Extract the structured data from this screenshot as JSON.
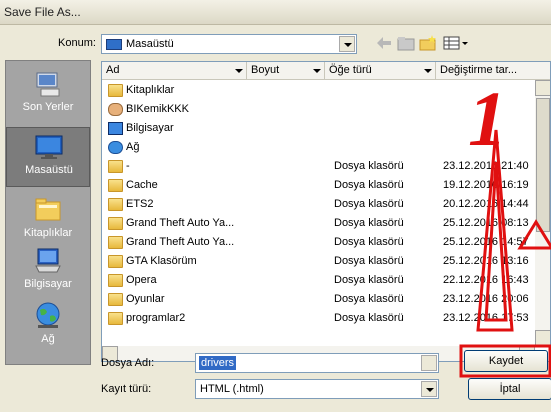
{
  "window": {
    "title": "Save File As..."
  },
  "location": {
    "label": "Konum:",
    "value": "Masaüstü"
  },
  "toolbar": {
    "icons": [
      "back-arrow-icon",
      "up-folder-icon",
      "new-folder-icon",
      "view-menu-icon"
    ]
  },
  "places": [
    {
      "label": "Son Yerler",
      "icon": "recent-places-icon"
    },
    {
      "label": "Masaüstü",
      "icon": "desktop-icon",
      "selected": true
    },
    {
      "label": "Kitaplıklar",
      "icon": "libraries-icon"
    },
    {
      "label": "Bilgisayar",
      "icon": "computer-icon"
    },
    {
      "label": "Ağ",
      "icon": "network-icon"
    }
  ],
  "columns": [
    "Ad",
    "Boyut",
    "Öğe türü",
    "Değiştirme tar..."
  ],
  "files": [
    {
      "name": "Kitaplıklar",
      "type": "",
      "date": "",
      "icon": "library-icon"
    },
    {
      "name": "BIKemikKKK",
      "type": "",
      "date": "",
      "icon": "user-icon"
    },
    {
      "name": "Bilgisayar",
      "type": "",
      "date": "",
      "icon": "computer-icon"
    },
    {
      "name": "Ağ",
      "type": "",
      "date": "",
      "icon": "network-icon"
    },
    {
      "name": "-",
      "type": "Dosya klasörü",
      "date": "23.12.2016 21:40",
      "icon": "folder-icon"
    },
    {
      "name": "Cache",
      "type": "Dosya klasörü",
      "date": "19.12.2016 16:19",
      "icon": "folder-icon"
    },
    {
      "name": "ETS2",
      "type": "Dosya klasörü",
      "date": "20.12.2016 14:44",
      "icon": "folder-icon"
    },
    {
      "name": "Grand Theft Auto Ya...",
      "type": "Dosya klasörü",
      "date": "25.12.2016 08:13",
      "icon": "folder-icon"
    },
    {
      "name": "Grand Theft Auto Ya...",
      "type": "Dosya klasörü",
      "date": "25.12.2016 14:57",
      "icon": "folder-icon"
    },
    {
      "name": "GTA Klasörüm",
      "type": "Dosya klasörü",
      "date": "25.12.2016 13:16",
      "icon": "folder-icon"
    },
    {
      "name": "Opera",
      "type": "Dosya klasörü",
      "date": "22.12.2016 16:43",
      "icon": "folder-icon"
    },
    {
      "name": "Oyunlar",
      "type": "Dosya klasörü",
      "date": "23.12.2016 20:06",
      "icon": "folder-icon"
    },
    {
      "name": "programlar2",
      "type": "Dosya klasörü",
      "date": "23.12.2016 17:53",
      "icon": "folder-icon"
    }
  ],
  "filename": {
    "label": "Dosya Adı:",
    "value": "drivers"
  },
  "filetype": {
    "label": "Kayıt türü:",
    "value": "HTML (.html)"
  },
  "buttons": {
    "save": "Kaydet",
    "cancel": "İptal"
  },
  "annotation": {
    "text": "1",
    "color": "#e01010"
  }
}
